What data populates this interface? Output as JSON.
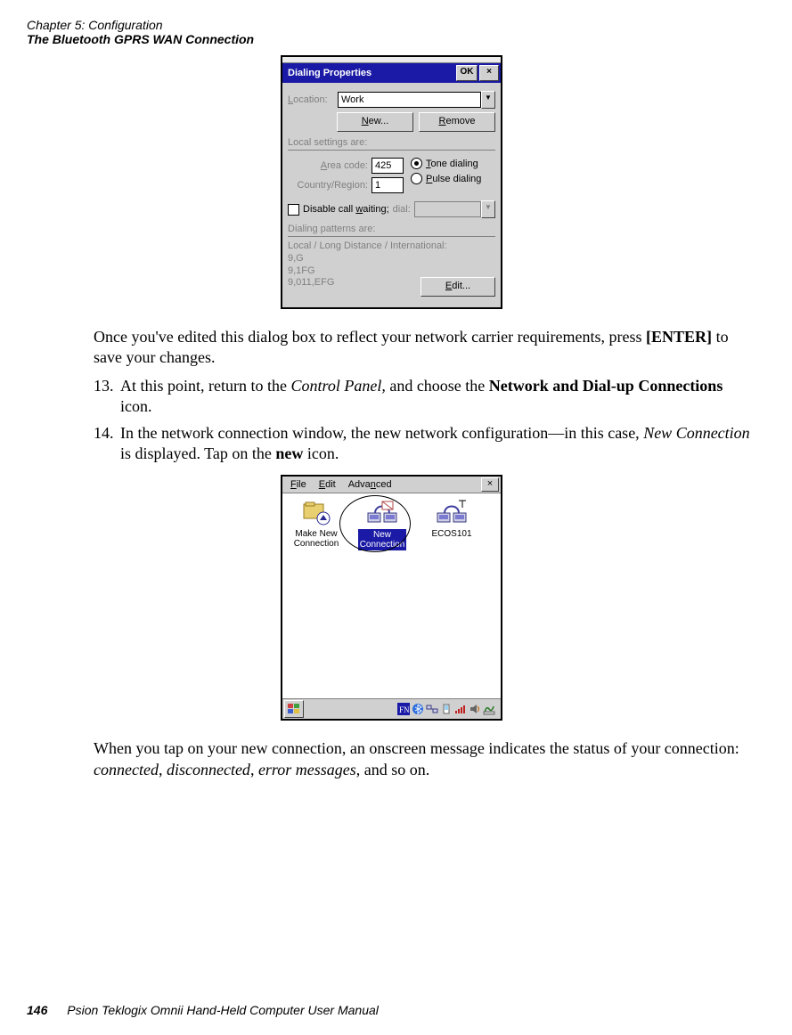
{
  "header": {
    "chapter": "Chapter 5:  Configuration",
    "section": "The Bluetooth GPRS WAN Connection"
  },
  "body": {
    "p1a": "Once you've edited this dialog box to reflect your network carrier requirements, press ",
    "p1b": "[ENTER]",
    "p1c": " to save your changes.",
    "s13_num": "13.",
    "s13_a": "At this point, return to the ",
    "s13_b": "Control Panel,",
    "s13_c": " and choose the ",
    "s13_d": "Network and Dial-up Connections",
    "s13_e": " icon.",
    "s14_num": "14.",
    "s14_a": "In the network connection window, the new network configuration—in this case, ",
    "s14_b": "New Connection",
    "s14_c": " is displayed. Tap on the ",
    "s14_d": "new",
    "s14_e": " icon.",
    "p2a": "When you tap on your new connection, an onscreen message indicates the status of your connection: ",
    "p2b": "connected",
    "p2c": ", ",
    "p2d": "disconnected",
    "p2e": ", ",
    "p2f": "error messages",
    "p2g": ", and so on."
  },
  "dlg1": {
    "title": "Dialing Properties",
    "ok": "OK",
    "close": "×",
    "location_lbl_pre": "L",
    "location_lbl_post": "ocation:",
    "location_val": "Work",
    "new_pre": "N",
    "new_post": "ew...",
    "remove_pre": "R",
    "remove_post": "emove",
    "local_settings": "Local settings are:",
    "area_code_pre": "A",
    "area_code_post": "rea code:",
    "area_code_val": "425",
    "country_lbl": "Country/Region:",
    "country_val": "1",
    "tone_pre": "T",
    "tone_post": "one dialing",
    "pulse_pre": "P",
    "pulse_post": "ulse dialing",
    "disable_cw_pre": "Disable call ",
    "disable_cw_u": "w",
    "disable_cw_post": "aiting;",
    "dial": "dial:",
    "patterns_l1": "Dialing patterns are:",
    "patterns_l2": "Local / Long Distance / International:",
    "patterns_l3": "9,G",
    "patterns_l4": "9,1FG",
    "patterns_l5": "9,011,EFG",
    "edit_pre": "E",
    "edit_post": "dit..."
  },
  "win2": {
    "menu_file_pre": "F",
    "menu_file_post": "ile",
    "menu_edit_pre": "E",
    "menu_edit_post": "dit",
    "menu_adv_pre": "Adva",
    "menu_adv_u": "n",
    "menu_adv_post": "ced",
    "close": "×",
    "make_new_l1": "Make New",
    "make_new_l2": "Connection",
    "newconn_l1": "New",
    "newconn_l2": "Connection",
    "ecos": "ECOS101"
  },
  "footer": {
    "page": "146",
    "book": "Psion Teklogix Omnii Hand-Held Computer User Manual"
  }
}
